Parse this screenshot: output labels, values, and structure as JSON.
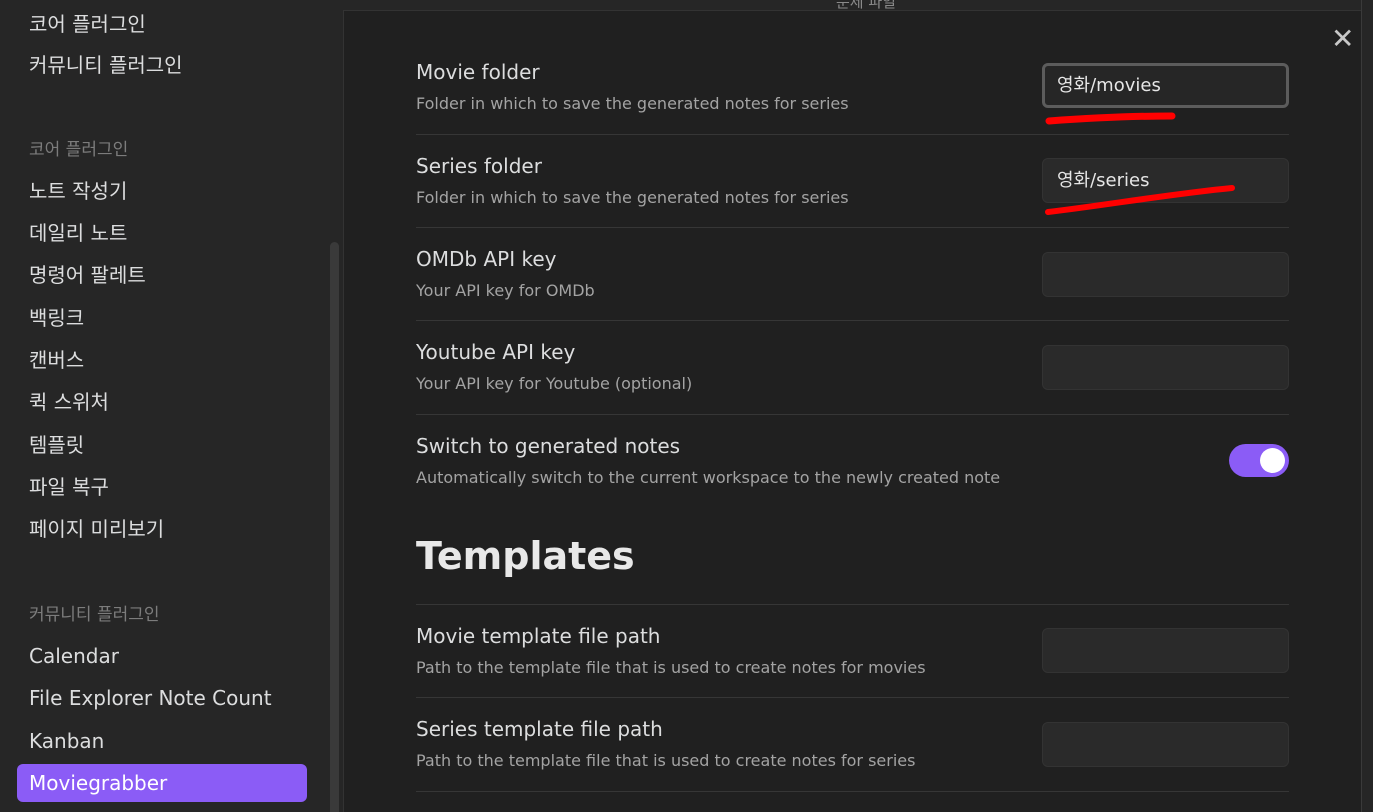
{
  "background_header_text": "문제 파일",
  "sidebar": {
    "top_items": [
      "코어 플러그인",
      "커뮤니티 플러그인"
    ],
    "core_heading": "코어 플러그인",
    "core_items": [
      "노트 작성기",
      "데일리 노트",
      "명령어 팔레트",
      "백링크",
      "캔버스",
      "퀵 스위처",
      "템플릿",
      "파일 복구",
      "페이지 미리보기"
    ],
    "community_heading": "커뮤니티 플러그인",
    "community_items": [
      "Calendar",
      "File Explorer Note Count",
      "Kanban",
      "Moviegrabber"
    ],
    "active_item": "Moviegrabber"
  },
  "settings": [
    {
      "title": "Movie folder",
      "desc": "Folder in which to save the generated notes for series",
      "type": "text",
      "value": "영화/movies",
      "focused": true
    },
    {
      "title": "Series folder",
      "desc": "Folder in which to save the generated notes for series",
      "type": "text",
      "value": "영화/series"
    },
    {
      "title": "OMDb API key",
      "desc": "Your API key for OMDb",
      "type": "text",
      "value": ""
    },
    {
      "title": "Youtube API key",
      "desc": "Your API key for Youtube (optional)",
      "type": "text",
      "value": ""
    },
    {
      "title": "Switch to generated notes",
      "desc": "Automatically switch to the current workspace to the newly created note",
      "type": "toggle",
      "enabled": true
    }
  ],
  "templates": {
    "heading": "Templates",
    "items": [
      {
        "title": "Movie template file path",
        "desc": "Path to the template file that is used to create notes for movies",
        "value": ""
      },
      {
        "title": "Series template file path",
        "desc": "Path to the template file that is used to create notes for series",
        "value": ""
      }
    ]
  },
  "close_glyph": "✕",
  "colors": {
    "accent": "#8b5cf6",
    "annotation": "#ff0000",
    "background": "#202020",
    "sidebar": "#262626"
  }
}
